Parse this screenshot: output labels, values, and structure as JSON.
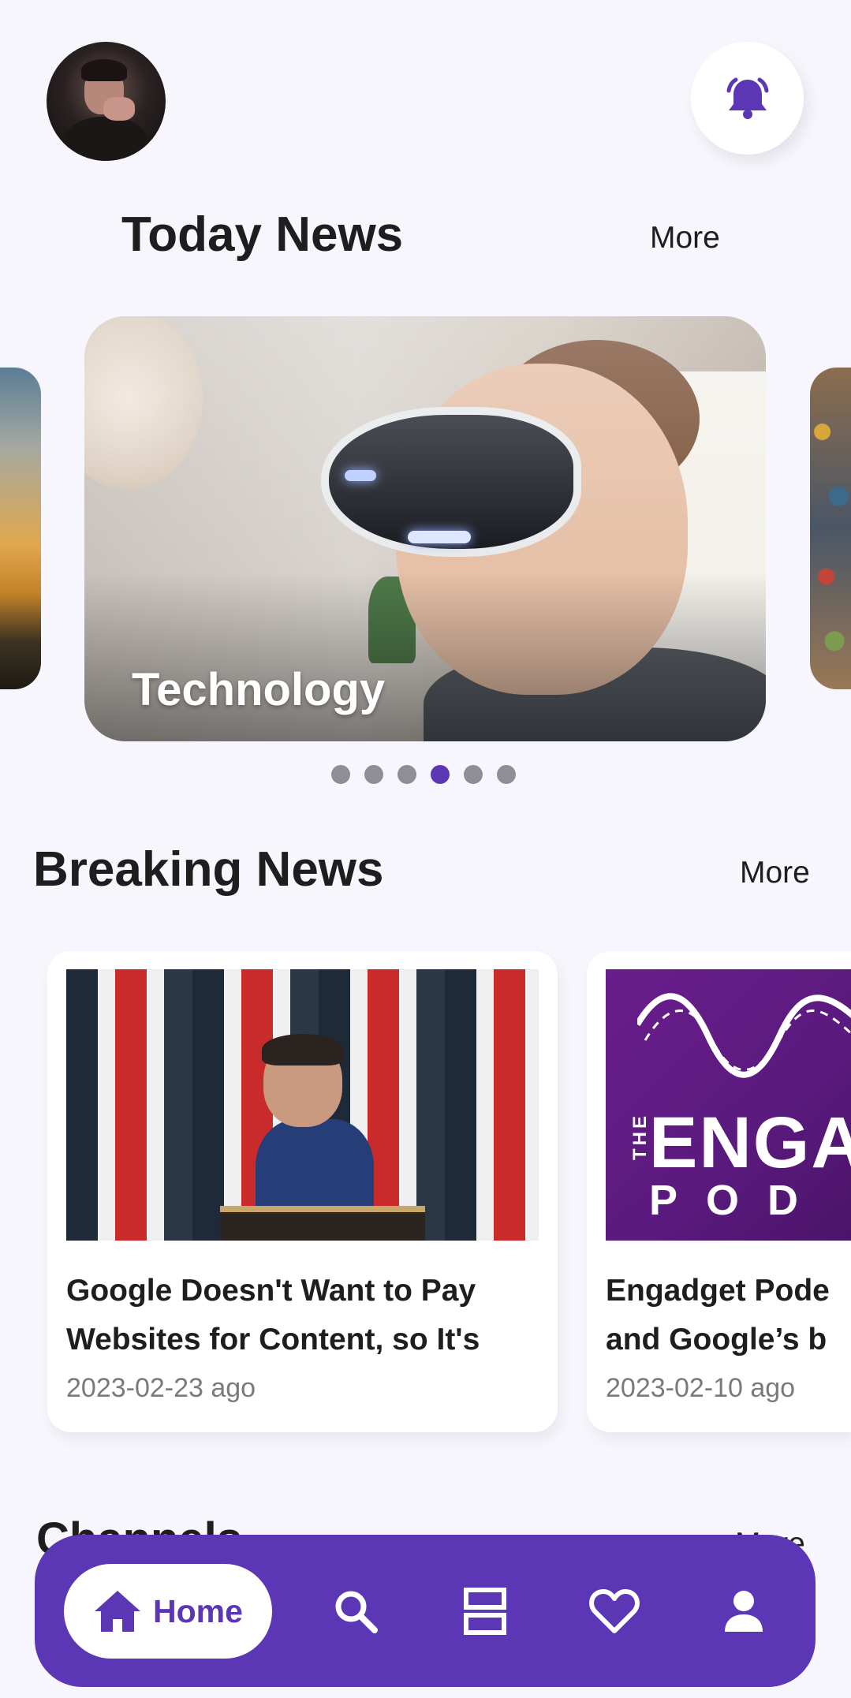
{
  "header": {
    "avatar_icon": "user-avatar",
    "notification_icon": "bell-icon"
  },
  "today": {
    "title": "Today News",
    "more": "More",
    "featured": {
      "label": "Technology"
    },
    "carousel": {
      "count": 6,
      "active_index": 3
    }
  },
  "breaking": {
    "title": "Breaking News",
    "more": "More",
    "cards": [
      {
        "title_line1": "Google Doesn't Want to Pay",
        "title_line2": "Websites for Content, so It's",
        "date": "2023-02-23 ago"
      },
      {
        "title_line1": "Engadget Pode",
        "title_line2": "and Google’s b",
        "date": "2023-02-10 ago",
        "image_text_the": "THE",
        "image_text_main": "ENGA",
        "image_text_sub": "POD"
      }
    ]
  },
  "channels": {
    "title": "Channels",
    "more": "More"
  },
  "nav": {
    "home_label": "Home",
    "items": [
      "home-icon",
      "search-icon",
      "grid-icon",
      "heart-icon",
      "profile-icon"
    ]
  },
  "colors": {
    "accent": "#5b36b5",
    "background": "#f7f6fc"
  }
}
